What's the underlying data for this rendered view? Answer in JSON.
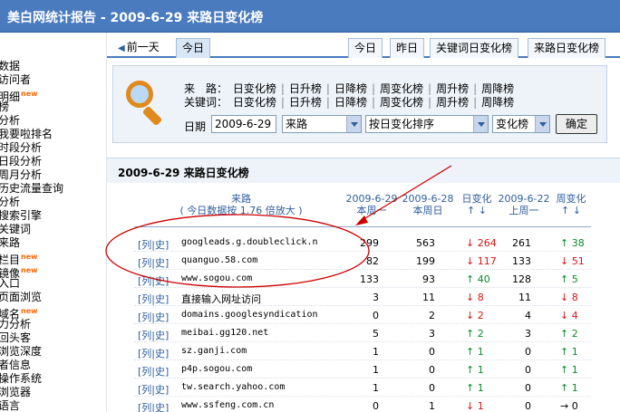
{
  "header": {
    "title": "美白网统计报告 - 2009-6-29 来路日变化榜"
  },
  "sidebar": {
    "items": [
      {
        "label": "数据",
        "new": false
      },
      {
        "label": "访问者",
        "new": false
      },
      {
        "label": "明细",
        "new": true
      },
      {
        "label": "榜",
        "new": false
      },
      {
        "label": "分析",
        "new": false
      },
      {
        "label": "我要啦排名",
        "new": false
      },
      {
        "label": "时段分析",
        "new": false
      },
      {
        "label": "日段分析",
        "new": false
      },
      {
        "label": "周月分析",
        "new": false
      },
      {
        "label": "历史流量查询",
        "new": false
      },
      {
        "label": "分析",
        "new": false
      },
      {
        "label": "搜索引擎",
        "new": false
      },
      {
        "label": "关键词",
        "new": false
      },
      {
        "label": "来路",
        "new": false
      },
      {
        "label": "栏目",
        "new": true
      },
      {
        "label": "镜像",
        "new": true
      },
      {
        "label": "入口",
        "new": false
      },
      {
        "label": "页面浏览",
        "new": false
      },
      {
        "label": "域名",
        "new": true
      },
      {
        "label": "力分析",
        "new": false
      },
      {
        "label": "回头客",
        "new": false
      },
      {
        "label": "浏览深度",
        "new": false
      },
      {
        "label": "者信息",
        "new": false
      },
      {
        "label": "操作系统",
        "new": false
      },
      {
        "label": "浏览器",
        "new": false
      },
      {
        "label": "语言",
        "new": false
      }
    ],
    "new_badge": "new"
  },
  "tabs": {
    "prev": "前一天",
    "today_active": "今日",
    "today": "今日",
    "yesterday": "昨日",
    "keyword_rank": "关键词日变化榜",
    "source_rank": "来路日变化榜"
  },
  "filter": {
    "source_label": "来　路：",
    "source_options": [
      "日变化榜",
      "日升榜",
      "日降榜",
      "周变化榜",
      "周升榜",
      "周降榜"
    ],
    "keyword_label": "关键词：",
    "keyword_options": [
      "日变化榜",
      "日升榜",
      "日降榜",
      "周变化榜",
      "周升榜",
      "周降榜"
    ],
    "date_label": "日期",
    "date_value": "2009-6-29",
    "type_select": "来路",
    "sort_select": "按日变化排序",
    "rank_select": "变化榜",
    "confirm_label": "确定"
  },
  "section": {
    "title": "2009-6-29 来路日变化榜"
  },
  "table": {
    "col_source": "来路",
    "col_source_note": "( 今日数据按 1.76 倍放大 )",
    "col_d1_date": "2009-6-29",
    "col_d1_day": "本周一",
    "col_d2_date": "2009-6-28",
    "col_d2_day": "本周日",
    "col_daychg": "日变化",
    "col_daychg_arrows": "↑ ↓",
    "col_d3_date": "2009-6-22",
    "col_d3_day": "上周一",
    "col_weekchg": "周变化",
    "col_weekchg_arrows": "↑ ↓",
    "action_list": "列",
    "action_hist": "史",
    "rows": [
      {
        "source": "googleads.g.doubleclick.n",
        "today": "299",
        "yday": "563",
        "daychg": "264",
        "daydir": "down",
        "lastweek": "261",
        "weekchg": "38",
        "weekdir": "up",
        "cn": false
      },
      {
        "source": "quanguo.58.com",
        "today": "82",
        "yday": "199",
        "daychg": "117",
        "daydir": "down",
        "lastweek": "133",
        "weekchg": "51",
        "weekdir": "down",
        "cn": false
      },
      {
        "source": "www.sogou.com",
        "today": "133",
        "yday": "93",
        "daychg": "40",
        "daydir": "up",
        "lastweek": "128",
        "weekchg": "5",
        "weekdir": "up",
        "cn": false
      },
      {
        "source": "直接输入网址访问",
        "today": "3",
        "yday": "11",
        "daychg": "8",
        "daydir": "down",
        "lastweek": "11",
        "weekchg": "8",
        "weekdir": "down",
        "cn": true
      },
      {
        "source": "domains.googlesyndication",
        "today": "0",
        "yday": "2",
        "daychg": "2",
        "daydir": "down",
        "lastweek": "4",
        "weekchg": "4",
        "weekdir": "down",
        "cn": false
      },
      {
        "source": "meibai.gg120.net",
        "today": "5",
        "yday": "3",
        "daychg": "2",
        "daydir": "up",
        "lastweek": "3",
        "weekchg": "2",
        "weekdir": "up",
        "cn": false
      },
      {
        "source": "sz.ganji.com",
        "today": "1",
        "yday": "0",
        "daychg": "1",
        "daydir": "up",
        "lastweek": "0",
        "weekchg": "1",
        "weekdir": "up",
        "cn": false
      },
      {
        "source": "p4p.sogou.com",
        "today": "1",
        "yday": "0",
        "daychg": "1",
        "daydir": "up",
        "lastweek": "0",
        "weekchg": "1",
        "weekdir": "up",
        "cn": false
      },
      {
        "source": "tw.search.yahoo.com",
        "today": "1",
        "yday": "0",
        "daychg": "1",
        "daydir": "up",
        "lastweek": "0",
        "weekchg": "1",
        "weekdir": "up",
        "cn": false
      },
      {
        "source": "www.ssfeng.com.cn",
        "today": "0",
        "yday": "1",
        "daychg": "1",
        "daydir": "down",
        "lastweek": "0",
        "weekchg": "0",
        "weekdir": "flat",
        "cn": false
      }
    ]
  },
  "icons": {
    "magnifier": "magnifier-icon",
    "dropdown": "chevron-down-icon",
    "up": "arrow-up-icon",
    "down": "arrow-down-icon",
    "flat": "arrow-right-icon"
  },
  "colors": {
    "header_bg": "#4a7bbf",
    "up": "#0a8a2a",
    "down": "#dd1111",
    "annotation": "#cc0000"
  }
}
